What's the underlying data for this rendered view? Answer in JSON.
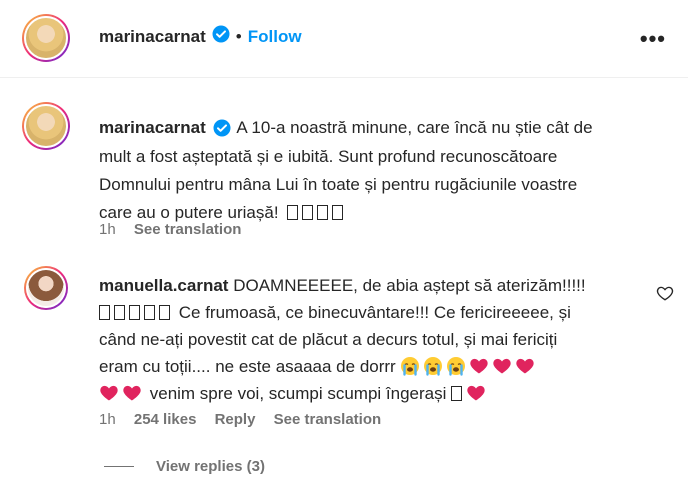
{
  "header": {
    "username": "marinacarnat",
    "separator": "•",
    "follow_label": "Follow",
    "more_label": "•••"
  },
  "post": {
    "username": "marinacarnat",
    "lines": [
      "A 10-a noastră minune, care încă nu știe cât de",
      "mult a fost așteptată și e iubită. Sunt profund recunoscătoare",
      "Domnului pentru mâna Lui în toate și pentru rugăciunile voastre",
      "care au o putere uriașă!"
    ],
    "time": "1h",
    "see_translation": "See translation"
  },
  "comment": {
    "username": "manuella.carnat",
    "line1": "DOAMNEEEEE, de abia aștept să aterizăm!!!!!",
    "line2": "Ce frumoasă, ce binecuvântare!!! Ce fericireeeee, și",
    "line3": "când ne-ați povestit cat de plăcut a decurs totul, și mai fericiți",
    "line4": "eram cu toții.... ne este asaaaa de dorrr",
    "line5": "venim spre voi, scumpi scumpi îngerași",
    "time": "1h",
    "likes": "254 likes",
    "reply_label": "Reply",
    "see_translation": "See translation",
    "view_replies": "View replies (3)"
  },
  "icons": {
    "verified": "verified-badge-icon",
    "heart": "heart-outline-icon",
    "crying": "loudly-crying-face-icon",
    "red_heart": "red-heart-icon"
  },
  "colors": {
    "accent": "#0095f6",
    "verified": "#0095f6",
    "muted": "#737373",
    "heart": "#e0245e"
  }
}
